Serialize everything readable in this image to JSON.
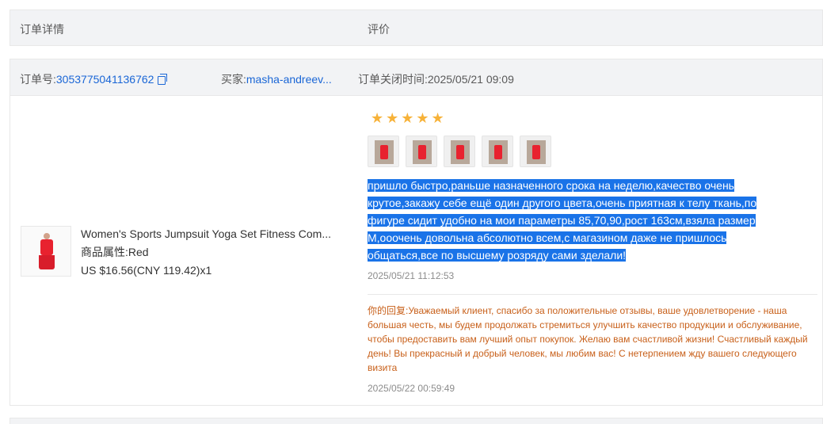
{
  "table_header": {
    "order_details": "订单详情",
    "review": "评价"
  },
  "order": {
    "order_no_label": "订单号:",
    "order_no": "3053775041136762",
    "buyer_label": "买家:",
    "buyer": "masha-andreev...",
    "closed_time": "订单关闭时间:2025/05/21 09:09"
  },
  "product": {
    "title": "Women's Sports Jumpsuit Yoga Set Fitness Com...",
    "attr_label": "商品属性:",
    "attr_value": "Red",
    "price": "US $16.56(CNY 119.42)x1"
  },
  "review": {
    "stars": "★★★★★",
    "rating": 5,
    "photo_count": 5,
    "text": "пришло быстро,раньше назначенного срока на неделю,качество очень крутое,закажу себе ещё один другого цвета,очень приятная к телу ткань,по фигуре сидит удобно на мои параметры 85,70,90,рост 163см,взяла размер М,ооочень довольна абсолютно всем,с магазином даже не пришлось общаться,все по высшему розряду сами зделали!",
    "date": "2025/05/21 11:12:53"
  },
  "reply": {
    "label": "你的回复:",
    "text": "Уважаемый клиент, спасибо за положительные отзывы, ваше удовлетворение - наша большая честь, мы будем продолжать стремиться улучшить качество продукции и обслуживание, чтобы предоставить вам лучший опыт покупок. Желаю вам счастливой жизни! Счастливый каждый день! Вы прекрасный и добрый человек, мы любим вас! С нетерпением жду вашего следующего визита",
    "date": "2025/05/22 00:59:49"
  },
  "colors": {
    "link": "#1a66d6",
    "star": "#f7b239",
    "selection": "#1a73e8",
    "reply": "#c8601a"
  }
}
